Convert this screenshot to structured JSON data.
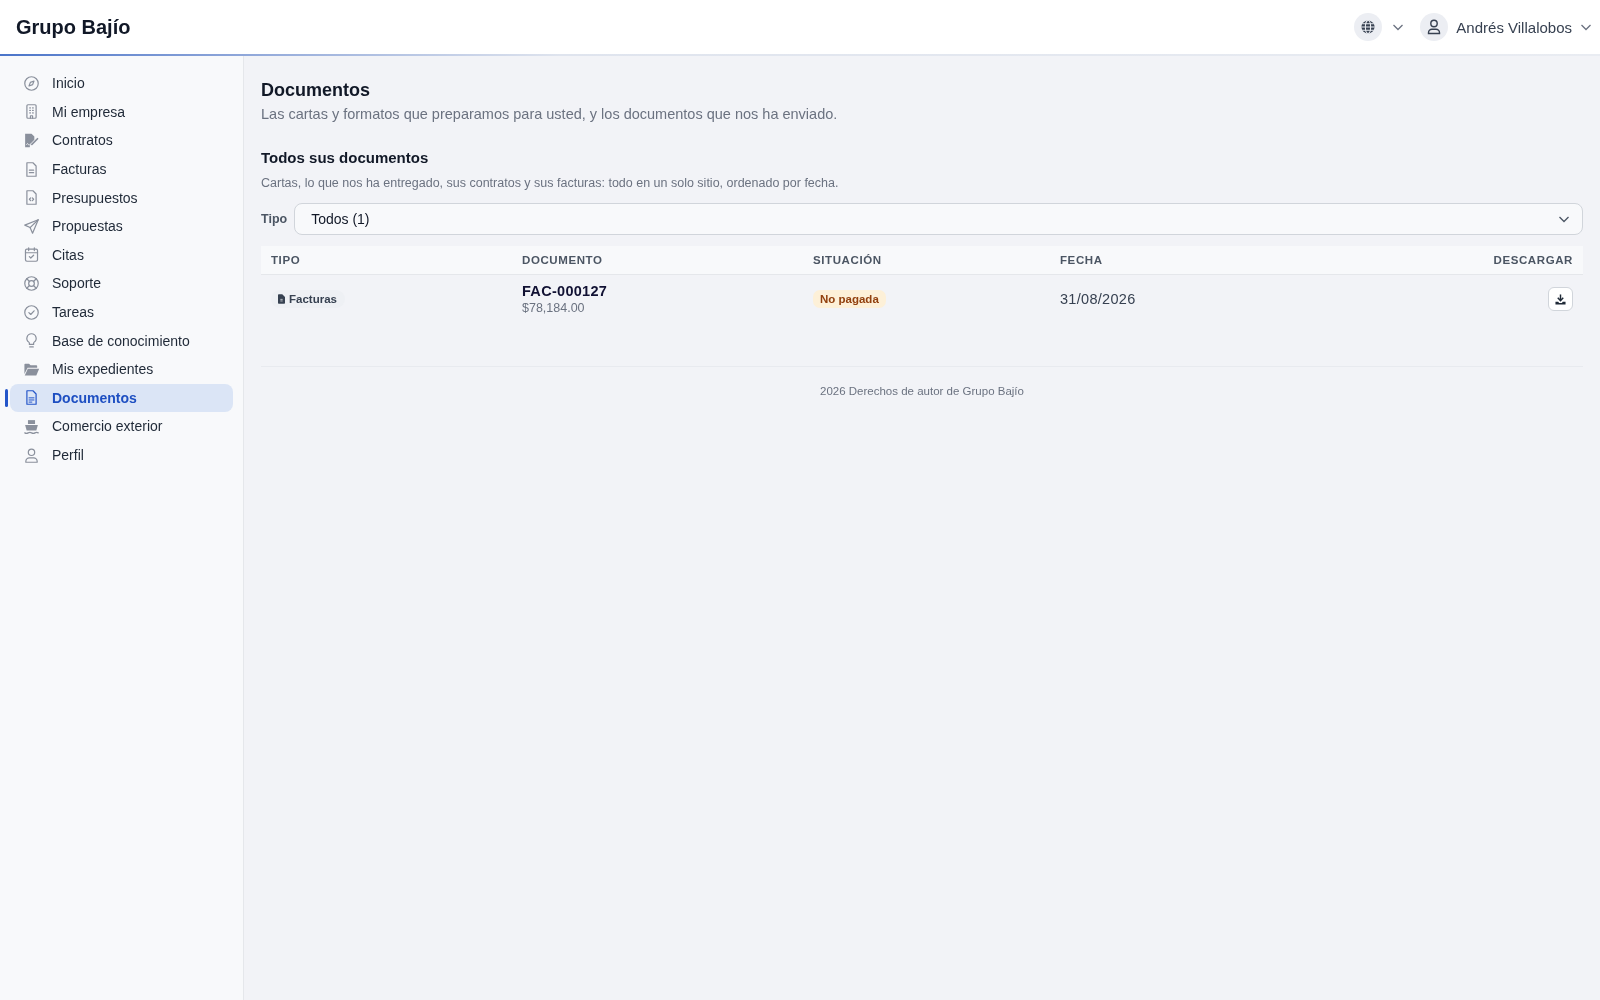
{
  "header": {
    "brand": "Grupo Bajío",
    "user_name": "Andrés Villalobos"
  },
  "sidebar": {
    "items": [
      {
        "label": "Inicio",
        "selected": false
      },
      {
        "label": "Mi empresa",
        "selected": false
      },
      {
        "label": "Contratos",
        "selected": false
      },
      {
        "label": "Facturas",
        "selected": false
      },
      {
        "label": "Presupuestos",
        "selected": false
      },
      {
        "label": "Propuestas",
        "selected": false
      },
      {
        "label": "Citas",
        "selected": false
      },
      {
        "label": "Soporte",
        "selected": false
      },
      {
        "label": "Tareas",
        "selected": false
      },
      {
        "label": "Base de conocimiento",
        "selected": false
      },
      {
        "label": "Mis expedientes",
        "selected": false
      },
      {
        "label": "Documentos",
        "selected": true
      },
      {
        "label": "Comercio exterior",
        "selected": false
      },
      {
        "label": "Perfil",
        "selected": false
      }
    ]
  },
  "page": {
    "title": "Documentos",
    "subtitle": "Las cartas y formatos que preparamos para usted, y los documentos que nos ha enviado."
  },
  "section": {
    "title": "Todos sus documentos",
    "description": "Cartas, lo que nos ha entregado, sus contratos y sus facturas: todo en un solo sitio, ordenado por fecha."
  },
  "filter": {
    "label": "Tipo",
    "value": "Todos (1)"
  },
  "table": {
    "columns": [
      "TIPO",
      "DOCUMENTO",
      "SITUACIÓN",
      "FECHA",
      "DESCARGAR"
    ],
    "rows": [
      {
        "type": "Facturas",
        "number": "FAC-000127",
        "amount": "$78,184.00",
        "status": {
          "label": "No pagada",
          "kind": "warning"
        },
        "date": "31/08/2026"
      }
    ]
  },
  "footer": {
    "text": "2026 Derechos de autor de Grupo Bajío"
  }
}
